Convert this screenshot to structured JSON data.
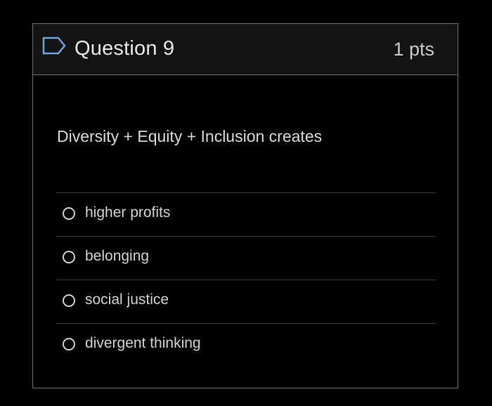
{
  "question": {
    "title": "Question 9",
    "points": "1 pts",
    "flag_icon": "flag-outline-icon",
    "text": "Diversity + Equity + Inclusion creates",
    "answers": [
      {
        "label": "higher profits",
        "selected": false
      },
      {
        "label": "belonging",
        "selected": false
      },
      {
        "label": "social justice",
        "selected": false
      },
      {
        "label": "divergent thinking",
        "selected": false
      }
    ]
  },
  "colors": {
    "background": "#000000",
    "header_background": "#141414",
    "border": "#6f6f6f",
    "flag_outline": "#6fa0d8",
    "text": "#d6d6d6"
  }
}
